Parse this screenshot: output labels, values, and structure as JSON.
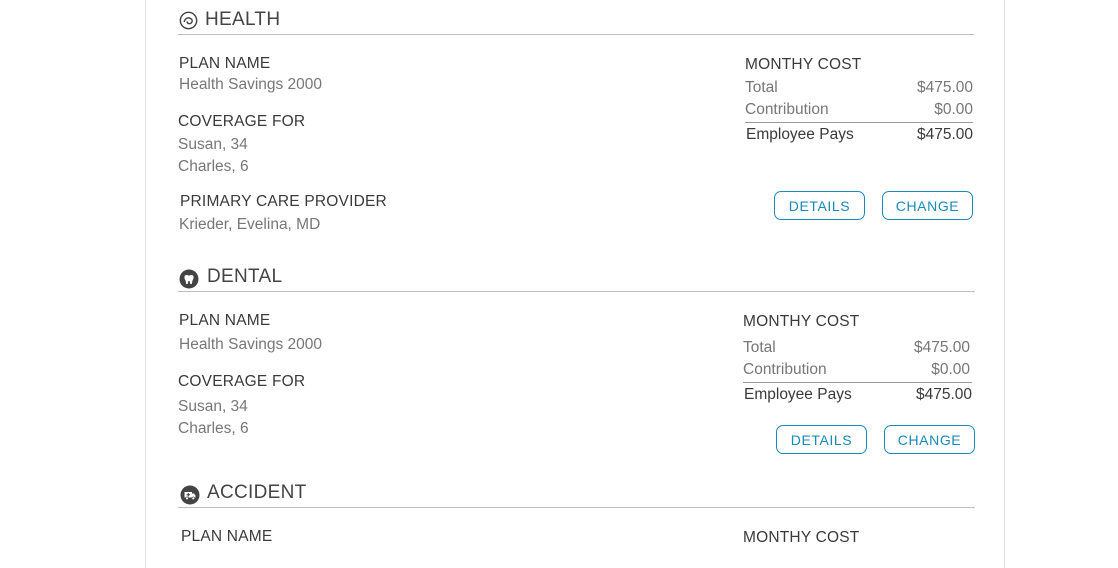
{
  "sections": [
    {
      "title": "HEALTH",
      "icon": "health-icon",
      "plan_label": "PLAN NAME",
      "plan_value": "Health Savings 2000",
      "coverage_label": "COVERAGE FOR",
      "coverage": [
        "Susan, 34",
        "Charles, 6"
      ],
      "pcp_label": "PRIMARY CARE PROVIDER",
      "pcp_value": "Krieder, Evelina, MD",
      "cost_label": "MONTHY COST",
      "total_label": "Total",
      "total_value": "$475.00",
      "contribution_label": "Contribution",
      "contribution_value": "$0.00",
      "employee_label": "Employee Pays",
      "employee_value": "$475.00",
      "details_label": "DETAILS",
      "change_label": "CHANGE"
    },
    {
      "title": "DENTAL",
      "icon": "tooth-icon",
      "plan_label": "PLAN NAME",
      "plan_value": "Health Savings 2000",
      "coverage_label": "COVERAGE FOR",
      "coverage": [
        "Susan, 34",
        "Charles, 6"
      ],
      "cost_label": "MONTHY COST",
      "total_label": "Total",
      "total_value": "$475.00",
      "contribution_label": "Contribution",
      "contribution_value": "$0.00",
      "employee_label": "Employee Pays",
      "employee_value": "$475.00",
      "details_label": "DETAILS",
      "change_label": "CHANGE"
    },
    {
      "title": "ACCIDENT",
      "icon": "ambulance-icon",
      "plan_label": "PLAN NAME",
      "cost_label": "MONTHY COST"
    }
  ],
  "colors": {
    "accent": "#1a8ab8",
    "divider": "#bdbdbd",
    "label": "#3a3a3a",
    "value": "#777777"
  }
}
